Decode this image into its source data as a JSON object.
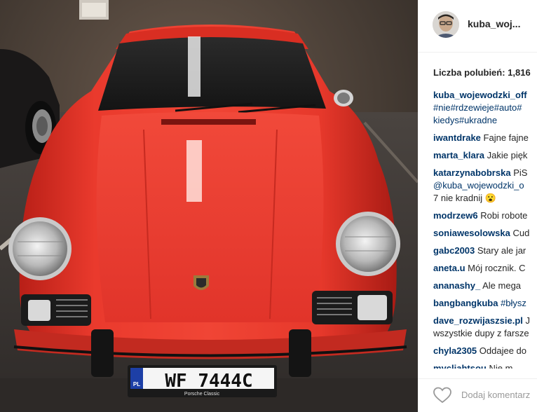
{
  "post": {
    "username": "kuba_woj...",
    "likes_text": "Liczba polubień: 1,816",
    "photo": {
      "plate": "WF 7444C",
      "plate_country": "PL",
      "plate_footer": "Porsche Classic"
    }
  },
  "comments": [
    {
      "user": "kuba_wojewodzki_off",
      "lines": [
        "#nie#rdzewieje#auto#",
        "kiedys#ukradne"
      ],
      "hashtag": true
    },
    {
      "user": "iwantdrake",
      "text": "Fajne fajne"
    },
    {
      "user": "marta_klara",
      "text": "Jakie pięk"
    },
    {
      "user": "katarzynabobrska",
      "text": "PiS",
      "extra_lines": [
        "@kuba_wojewodzki_o",
        "7 nie kradnij 😮"
      ]
    },
    {
      "user": "modrzew6",
      "text": "Robi robote"
    },
    {
      "user": "soniawesolowska",
      "text": "Cud"
    },
    {
      "user": "gabc2003",
      "text": "Stary ale jar"
    },
    {
      "user": "aneta.u",
      "text": "Mój rocznik. C"
    },
    {
      "user": "ananashy_",
      "text": "Ale mega"
    },
    {
      "user": "bangbangkuba",
      "text": "#błysz",
      "hashtag_text": true
    },
    {
      "user": "dave_rozwijaszsie.pl",
      "text": "J",
      "extra_lines": [
        "wszystkie dupy z farsze"
      ]
    },
    {
      "user": "chyla2305",
      "text": "Oddajee do"
    },
    {
      "user": "mycliahtsou",
      "text": "Nie m"
    }
  ],
  "footer": {
    "add_comment_placeholder": "Dodaj komentarz"
  },
  "icons": {
    "like": "heart-icon"
  },
  "colors": {
    "username_link": "#003569",
    "text": "#262626",
    "placeholder": "#999999",
    "car_red": "#e8352a"
  }
}
